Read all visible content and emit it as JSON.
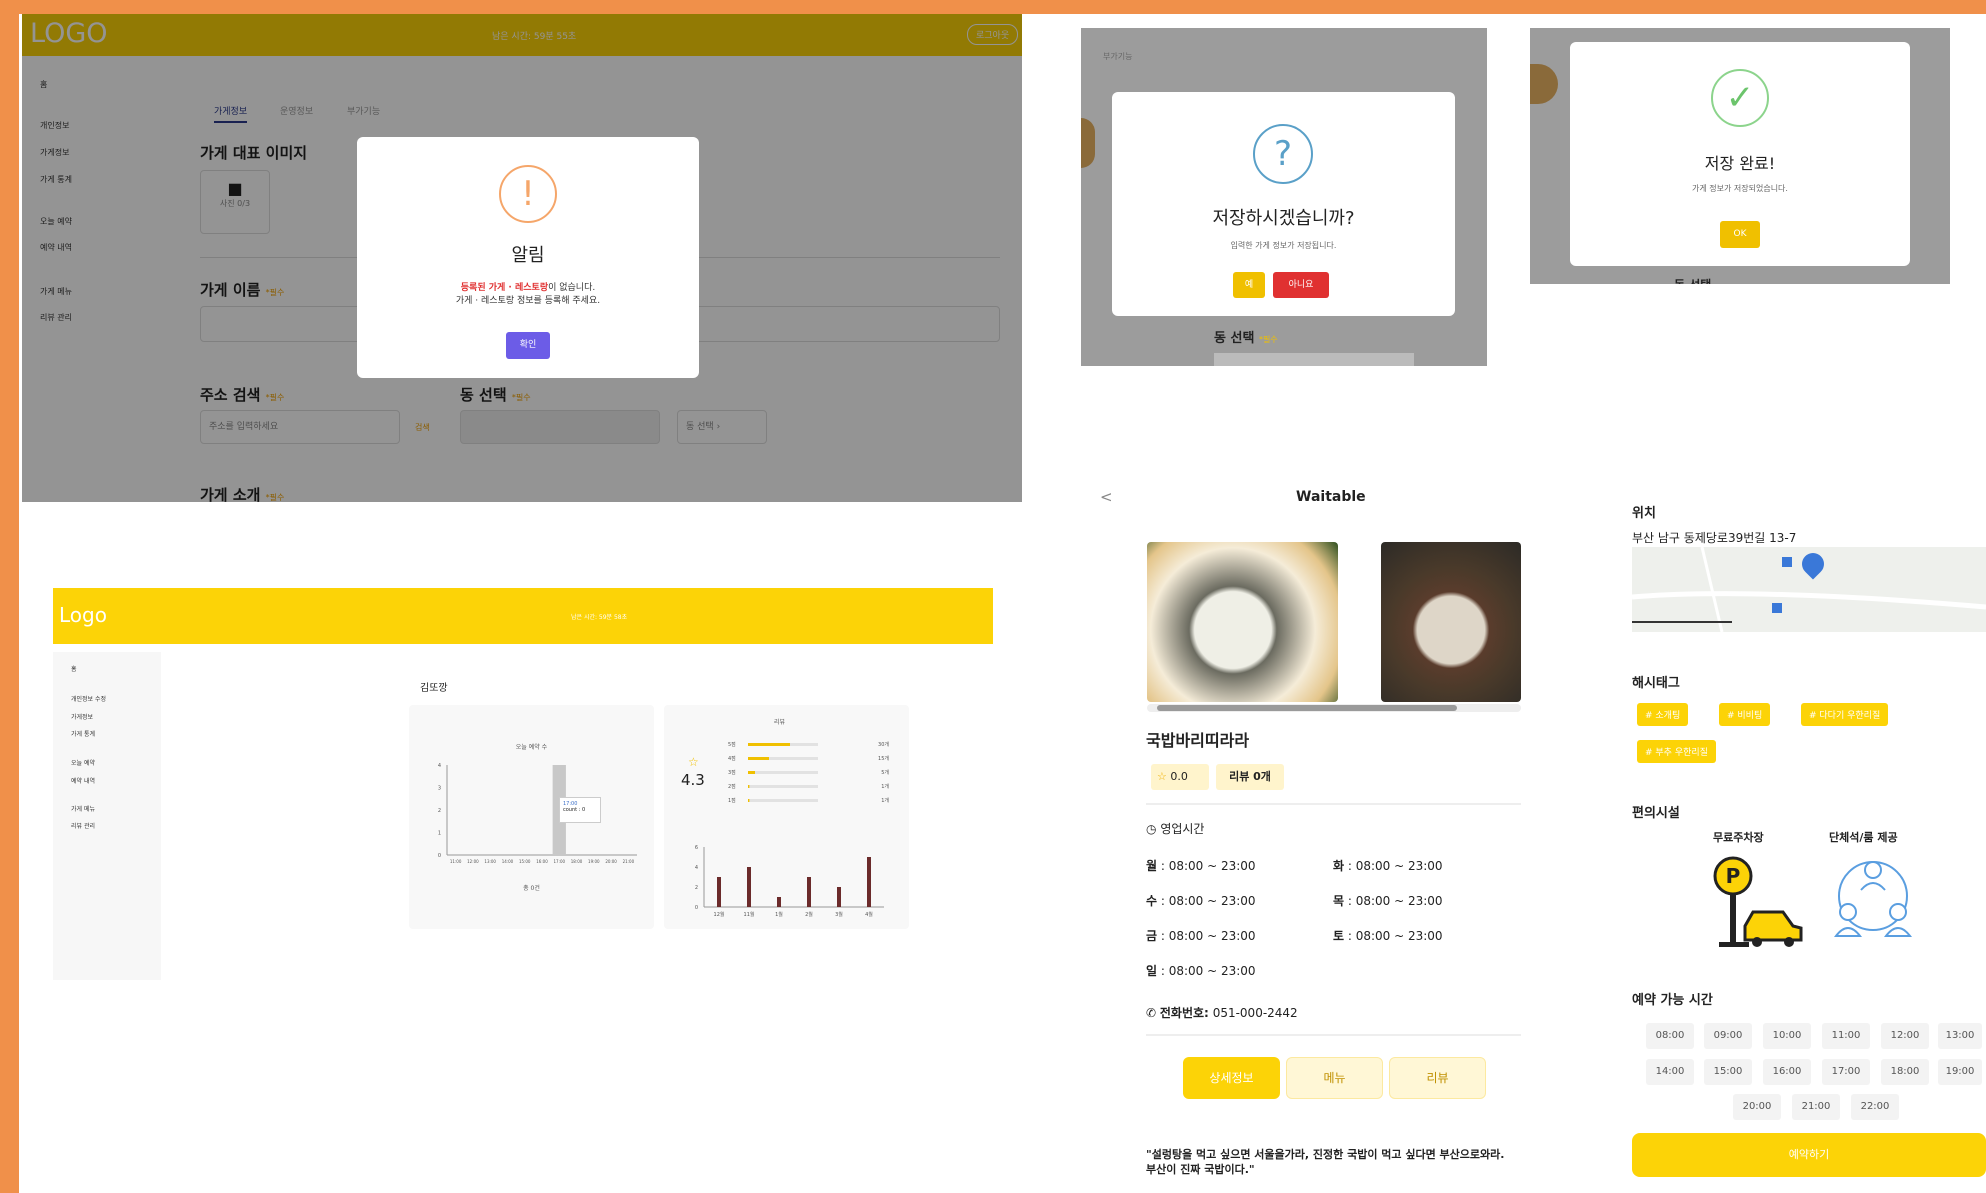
{
  "panel_admin_alert": {
    "logo": "LOGO",
    "session_time": "남은 시간: 59분 55초",
    "logout": "로그아웃",
    "sidebar": [
      "홈",
      "개인정보",
      "가게정보",
      "가게 통계",
      "오늘 예약",
      "예약 내역",
      "가게 메뉴",
      "리뷰 관리"
    ],
    "tabs": [
      "가게정보",
      "운영정보",
      "부가기능"
    ],
    "sections": {
      "image": "가게 대표 이미지",
      "photo_count": "사진 0/3",
      "name": "가게 이름",
      "address": "주소 검색",
      "dong": "동 선택",
      "intro": "가게 소개",
      "required": "*필수"
    },
    "address_placeholder": "주소를 입력하세요",
    "search_btn": "검색",
    "dong_select": "동 선택",
    "alert": {
      "title": "알림",
      "highlight": "등록된 가게 · 레스토랑",
      "line1_rest": "이 없습니다.",
      "line2": "가게 · 레스토랑 정보를 등록해 주세요.",
      "confirm": "확인"
    }
  },
  "panel_save_confirm": {
    "top_tab": "부가기능",
    "title": "저장하시겠습니까?",
    "subtitle": "입력한 가게 정보가 저장됩니다.",
    "yes": "예",
    "no": "아니요",
    "section": "동 선택",
    "required": "*필수"
  },
  "panel_save_done": {
    "title": "저장 완료!",
    "subtitle": "가게 정보가 저장되었습니다.",
    "ok": "OK",
    "section": "동 선택"
  },
  "panel_stats": {
    "logo": "Logo",
    "session_time": "남은 시간: 59분 58초",
    "sidebar": [
      "홈",
      "개인정보 수정",
      "가게정보",
      "가게 통계",
      "오늘 예약",
      "예약 내역",
      "가게 메뉴",
      "리뷰 관리"
    ],
    "store_name": "김또깡",
    "today_chart_title": "오늘 예약 수",
    "today_chart_footer": "총 0건",
    "tooltip_time": "17:00",
    "tooltip_count": "count : 0",
    "review_title": "리뷰",
    "rating": "4.3"
  },
  "chart_data": [
    {
      "type": "bar",
      "title": "오늘 예약 수",
      "categories": [
        "11:00",
        "12:00",
        "13:00",
        "14:00",
        "15:00",
        "16:00",
        "17:00",
        "18:00",
        "19:00",
        "20:00",
        "21:00"
      ],
      "values": [
        0,
        0,
        0,
        0,
        0,
        0,
        0,
        0,
        0,
        0,
        0
      ],
      "ylim": [
        0,
        4
      ],
      "yticks": [
        "0",
        "1",
        "2",
        "3",
        "4"
      ]
    },
    {
      "type": "bar",
      "title": "리뷰",
      "categories": [
        "5점",
        "4점",
        "3점",
        "2점",
        "1점"
      ],
      "values": [
        30,
        15,
        5,
        1,
        1
      ],
      "value_labels": [
        "30개",
        "15개",
        "5개",
        "1개",
        "1개"
      ]
    },
    {
      "type": "bar",
      "categories": [
        "12월",
        "11월",
        "1월",
        "2월",
        "3월",
        "4월"
      ],
      "values": [
        3,
        4,
        1,
        3,
        2,
        5
      ],
      "ylim": [
        0,
        6
      ],
      "yticks": [
        "0",
        "2",
        "4",
        "6"
      ]
    }
  ],
  "mobile_detail": {
    "back": "<",
    "app_name": "Waitable",
    "store_name": "국밥바리띠라라",
    "rating": "0.0",
    "review_count": "리뷰 0개",
    "hours_title": "영업시간",
    "hours": [
      {
        "day": "월",
        "time": " : 08:00 ~ 23:00"
      },
      {
        "day": "화",
        "time": " : 08:00 ~ 23:00"
      },
      {
        "day": "수",
        "time": " : 08:00 ~ 23:00"
      },
      {
        "day": "목",
        "time": " : 08:00 ~ 23:00"
      },
      {
        "day": "금",
        "time": " : 08:00 ~ 23:00"
      },
      {
        "day": "토",
        "time": " : 08:00 ~ 23:00"
      },
      {
        "day": "일",
        "time": " : 08:00 ~ 23:00"
      }
    ],
    "phone_label": "전화번호:",
    "phone": "051-000-2442",
    "tabs": [
      "상세정보",
      "메뉴",
      "리뷰"
    ],
    "quote": "\"설렁탕을 먹고 싶으면 서울을가라, 진정한 국밥이 먹고 싶다면 부산으로와라. 부산이 진짜 국밥이다.\""
  },
  "mobile_location": {
    "location_title": "위치",
    "address": "부산 남구 동제당로39번길 13-7",
    "hashtag_title": "해시태그",
    "hashtags": [
      "# 소개팅",
      "# 비비팅",
      "# 다다기 우한리질",
      "# 부추 우한리질"
    ],
    "facility_title": "편의시설",
    "facilities": [
      "무료주차장",
      "단체석/룸 제공"
    ],
    "reservation_title": "예약 가능 시간",
    "times": [
      "08:00",
      "09:00",
      "10:00",
      "11:00",
      "12:00",
      "13:00",
      "14:00",
      "15:00",
      "16:00",
      "17:00",
      "18:00",
      "19:00",
      "20:00",
      "21:00",
      "22:00"
    ],
    "reserve_btn": "예약하기"
  },
  "colors": {
    "frame": "#f0904a",
    "yellow": "#fcd307",
    "purple": "#6c5ce7",
    "red": "#e03131",
    "brown": "#6b2b2b"
  }
}
